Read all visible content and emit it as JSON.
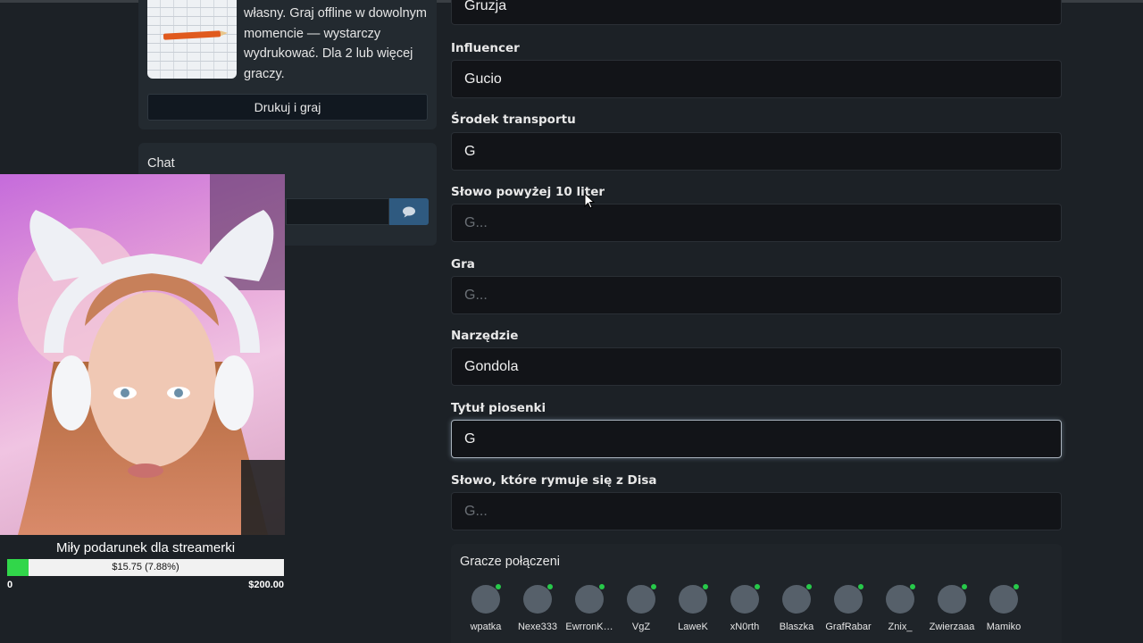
{
  "print_card": {
    "description": "własny. Graj offline w dowolnym\nmomencie — wystarczy\nwydrukować. Dla 2 lub więcej\ngraczy.",
    "button_label": "Drukuj i graj"
  },
  "chat": {
    "title": "Chat",
    "send_icon": "speech-bubble-icon"
  },
  "donation": {
    "title": "Miły podarunek dla streamerki",
    "amount_text": "$15.75 (7.88%)",
    "progress_percent": 7.88,
    "min_label": "0",
    "max_label": "$200.00",
    "fill_color": "#31d64a"
  },
  "form": {
    "fields": [
      {
        "label": "",
        "value": "Gruzja",
        "placeholder": ""
      },
      {
        "label": "Influencer",
        "value": "Gucio",
        "placeholder": ""
      },
      {
        "label": "Środek transportu",
        "value": "G",
        "placeholder": ""
      },
      {
        "label": "Słowo powyżej 10 liter",
        "value": "",
        "placeholder": "G..."
      },
      {
        "label": "Gra",
        "value": "",
        "placeholder": "G..."
      },
      {
        "label": "Narzędzie",
        "value": "Gondola",
        "placeholder": ""
      },
      {
        "label": "Tytuł piosenki",
        "value": "G",
        "placeholder": ""
      },
      {
        "label": "Słowo, które rymuje się z Disa",
        "value": "",
        "placeholder": "G..."
      }
    ]
  },
  "players": {
    "title": "Gracze połączeni",
    "list": [
      "wpatka",
      "Nexe333",
      "EwrronK…",
      "VgZ",
      "LaweK",
      "xN0rth",
      "Blaszka",
      "GrafRabar",
      "Znix_",
      "Zwierzaaa",
      "Mamiko"
    ]
  },
  "colors": {
    "background": "#1c2126",
    "input_bg": "#121418",
    "online_dot": "#27c94a"
  }
}
